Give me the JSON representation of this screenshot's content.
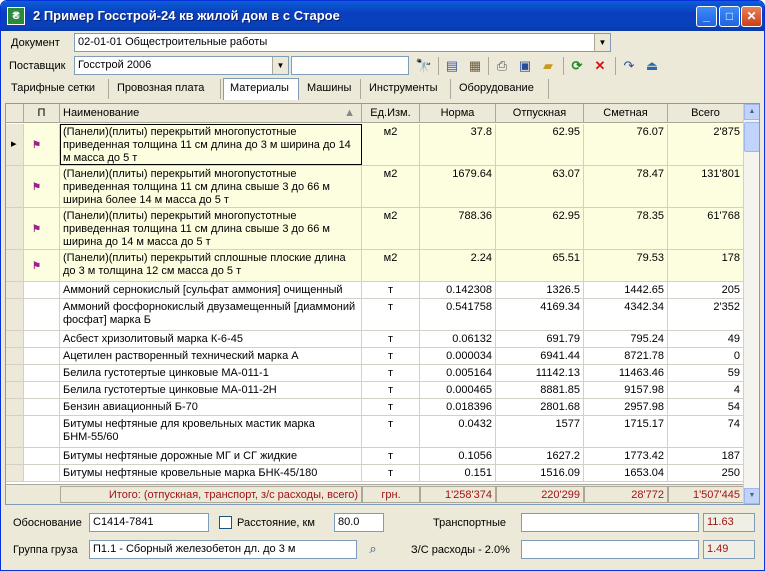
{
  "window": {
    "title": "2  Пример Госстрой-24 кв жилой дом в с Старое",
    "icon": "app-icon",
    "controls": [
      "_",
      "□",
      "✕"
    ]
  },
  "document": {
    "label": "Документ",
    "value": "02-01-01  Общестроительные работы"
  },
  "supplier": {
    "label": "Поставщик",
    "value": "Госстрой 2006",
    "search_value": ""
  },
  "toolbar": {
    "icons": [
      "binoculars-icon",
      "notebook-icon",
      "stamp-icon",
      "print-icon",
      "save-icon",
      "open-folder-icon",
      "refresh-icon",
      "delete-icon",
      "undo-icon",
      "export-icon"
    ]
  },
  "tabs": [
    {
      "label": "Тарифные сетки",
      "active": false
    },
    {
      "label": "Провозная плата",
      "active": false
    },
    {
      "label": "Материалы",
      "active": true
    },
    {
      "label": "Машины",
      "active": false
    },
    {
      "label": "Инструменты",
      "active": false
    },
    {
      "label": "Оборудование",
      "active": false
    }
  ],
  "table": {
    "columns": [
      "П",
      "Наименование",
      "Ед.Изм.",
      "Норма",
      "Отпускная",
      "Сметная",
      "Всего"
    ],
    "rows": [
      {
        "flag": true,
        "highlight": true,
        "current": true,
        "name": "(Панели)(плиты) перекрытий многопустотные приведенная толщина 11 см длина до 3 м ширина до 14 м масса до 5 т",
        "unit": "м2",
        "norm": "37.8",
        "release": "62.95",
        "estimate": "76.07",
        "total": "2'875"
      },
      {
        "flag": true,
        "highlight": true,
        "current": false,
        "name": "(Панели)(плиты) перекрытий многопустотные приведенная толщина 11 см длина свыше 3 до 66 м ширина более 14 м масса до 5 т",
        "unit": "м2",
        "norm": "1679.64",
        "release": "63.07",
        "estimate": "78.47",
        "total": "131'801"
      },
      {
        "flag": true,
        "highlight": true,
        "current": false,
        "name": "(Панели)(плиты) перекрытий многопустотные приведенная толщина 11 см длина свыше 3 до 66 м ширина до 14 м масса до 5 т",
        "unit": "м2",
        "norm": "788.36",
        "release": "62.95",
        "estimate": "78.35",
        "total": "61'768"
      },
      {
        "flag": true,
        "highlight": true,
        "current": false,
        "name": "(Панели)(плиты) перекрытий сплошные плоские длина до 3 м толщина 12 см масса до 5 т",
        "unit": "м2",
        "norm": "2.24",
        "release": "65.51",
        "estimate": "79.53",
        "total": "178"
      },
      {
        "flag": false,
        "highlight": false,
        "current": false,
        "name": "Аммоний сернокислый [сульфат аммония] очищенный",
        "unit": "т",
        "norm": "0.142308",
        "release": "1326.5",
        "estimate": "1442.65",
        "total": "205"
      },
      {
        "flag": false,
        "highlight": false,
        "current": false,
        "name": "Аммоний фосфорнокислый двузамещенный [диаммоний фосфат] марка Б",
        "unit": "т",
        "norm": "0.541758",
        "release": "4169.34",
        "estimate": "4342.34",
        "total": "2'352"
      },
      {
        "flag": false,
        "highlight": false,
        "current": false,
        "name": "Асбест хризолитовый марка К-6-45",
        "unit": "т",
        "norm": "0.06132",
        "release": "691.79",
        "estimate": "795.24",
        "total": "49"
      },
      {
        "flag": false,
        "highlight": false,
        "current": false,
        "name": "Ацетилен растворенный технический марка А",
        "unit": "т",
        "norm": "0.000034",
        "release": "6941.44",
        "estimate": "8721.78",
        "total": "0"
      },
      {
        "flag": false,
        "highlight": false,
        "current": false,
        "name": "Белила густотертые цинковые МА-011-1",
        "unit": "т",
        "norm": "0.005164",
        "release": "11142.13",
        "estimate": "11463.46",
        "total": "59"
      },
      {
        "flag": false,
        "highlight": false,
        "current": false,
        "name": "Белила густотертые цинковые МА-011-2Н",
        "unit": "т",
        "norm": "0.000465",
        "release": "8881.85",
        "estimate": "9157.98",
        "total": "4"
      },
      {
        "flag": false,
        "highlight": false,
        "current": false,
        "name": "Бензин авиационный Б-70",
        "unit": "т",
        "norm": "0.018396",
        "release": "2801.68",
        "estimate": "2957.98",
        "total": "54"
      },
      {
        "flag": false,
        "highlight": false,
        "current": false,
        "name": "Битумы нефтяные для кровельных мастик марка БНМ-55/60",
        "unit": "т",
        "norm": "0.0432",
        "release": "1577",
        "estimate": "1715.17",
        "total": "74"
      },
      {
        "flag": false,
        "highlight": false,
        "current": false,
        "name": "Битумы нефтяные дорожные МГ и СГ жидкие",
        "unit": "т",
        "norm": "0.1056",
        "release": "1627.2",
        "estimate": "1773.42",
        "total": "187"
      },
      {
        "flag": false,
        "highlight": false,
        "current": false,
        "name": "Битумы нефтяные кровельные марка БНК-45/180",
        "unit": "т",
        "norm": "0.151",
        "release": "1516.09",
        "estimate": "1653.04",
        "total": "250"
      }
    ],
    "totals": {
      "label": "Итого: (отпускная, транспорт, з/с расходы, всего)",
      "unit": "грн.",
      "release": "1'258'374",
      "transport": "220'299",
      "overhead": "28'772",
      "total": "1'507'445"
    }
  },
  "footer": {
    "justification_label": "Обоснование",
    "justification_value": "С1414-7841",
    "distance_label": "Расстояние, км",
    "distance_checked": false,
    "distance_value": "80.0",
    "cargo_group_label": "Группа груза",
    "cargo_group_value": "П1.1 - Сборный железобетон дл. до 3 м",
    "transport_label": "Транспортные",
    "transport_value": "",
    "transport_amount": "11.63",
    "overhead_label": "З/С расходы - 2.0%",
    "overhead_value": "",
    "overhead_amount": "1.49"
  }
}
